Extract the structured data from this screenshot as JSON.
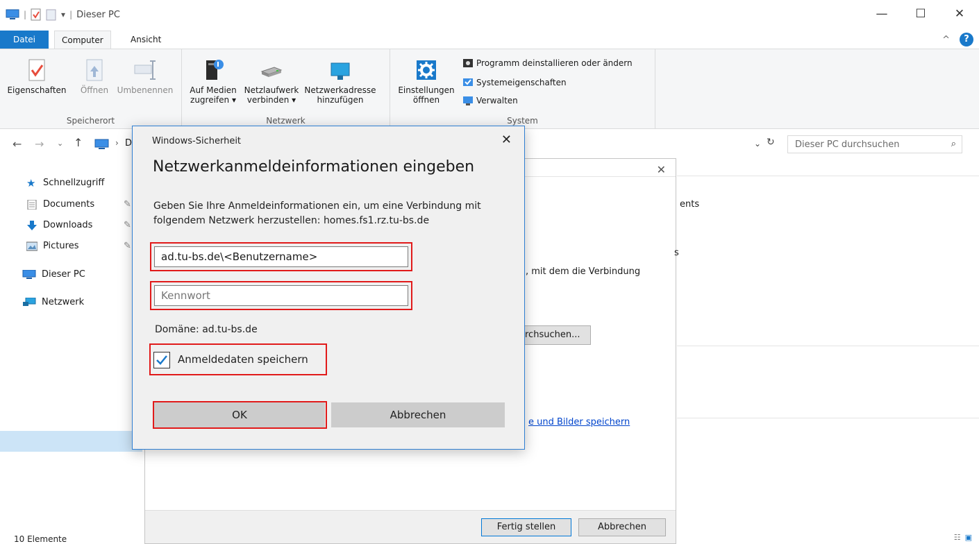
{
  "window": {
    "title": "Dieser PC",
    "minimize": "—",
    "maximize": "☐",
    "close": "✕"
  },
  "tabs": {
    "datei": "Datei",
    "computer": "Computer",
    "ansicht": "Ansicht"
  },
  "ribbon": {
    "groups": {
      "speicherort": "Speicherort",
      "netzwerk": "Netzwerk",
      "system": "System"
    },
    "eigenschaften": "Eigenschaften",
    "oeffnen": "Öffnen",
    "umbenennen": "Umbenennen",
    "auf_medien": "Auf Medien",
    "zugreifen": "zugreifen ▾",
    "netzlaufwerk": "Netzlaufwerk",
    "verbinden": "verbinden ▾",
    "netzwerkadresse": "Netzwerkadresse",
    "hinzufuegen": "hinzufügen",
    "einstellungen": "Einstellungen",
    "einstellungen_oeffnen": "öffnen",
    "programm": "Programm deinstallieren oder ändern",
    "systemeigenschaften": "Systemeigenschaften",
    "verwalten": "Verwalten"
  },
  "address": {
    "crumb": "D",
    "search_placeholder": "Dieser PC durchsuchen"
  },
  "nav": {
    "schnellzugriff": "Schnellzugriff",
    "documents": "Documents",
    "downloads": "Downloads",
    "pictures": "Pictures",
    "dieser_pc": "Dieser PC",
    "netzwerk": "Netzwerk"
  },
  "status": {
    "count": "10 Elemente"
  },
  "wizard": {
    "frag1": "ents",
    "frag2": "s",
    "frag3": ", mit dem die Verbindung",
    "frag4": "rchsuchen...",
    "frag_link": "e und Bilder speichern",
    "finish": "Fertig stellen",
    "cancel": "Abbrechen"
  },
  "dialog": {
    "caption": "Windows-Sicherheit",
    "heading": "Netzwerkanmeldeinformationen eingeben",
    "message": "Geben Sie Ihre Anmeldeinformationen ein, um eine Verbindung mit folgendem Netzwerk herzustellen: homes.fs1.rz.tu-bs.de",
    "username": "ad.tu-bs.de\\<Benutzername>",
    "password_placeholder": "Kennwort",
    "domain": "Domäne: ad.tu-bs.de",
    "remember": "Anmeldedaten speichern",
    "ok": "OK",
    "cancel": "Abbrechen"
  },
  "colors": {
    "accent": "#1979ca",
    "highlight": "#e11a1a",
    "selection": "#cce4f7"
  }
}
